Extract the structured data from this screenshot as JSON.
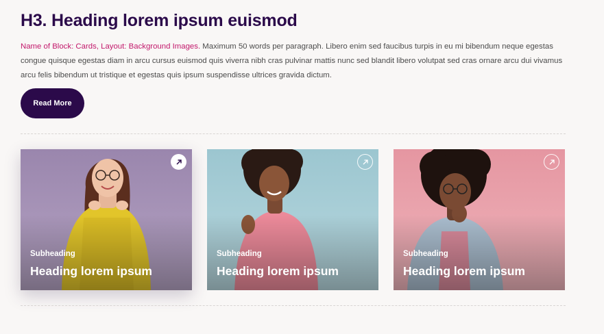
{
  "section": {
    "heading": "H3. Heading lorem ipsum euismod",
    "paragraph_highlight": "Name of Block: Cards, Layout: Background Images.",
    "paragraph_text": " Maximum 50 words per paragraph. Libero enim sed faucibus turpis in eu mi bibendum neque egestas congue quisque egestas diam in arcu cursus euismod quis viverra nibh cras pulvinar mattis nunc sed blandit libero volutpat sed cras ornare arcu dui vivamus arcu felis bibendum ut tristique et egestas quis ipsum suspendisse ultrices gravida dictum.",
    "button_label": "Read More"
  },
  "cards": [
    {
      "subheading": "Subheading",
      "heading": "Heading lorem ipsum",
      "icon": "arrow-up-right-icon",
      "background": "#a995b8",
      "sweater": "#e2c52a"
    },
    {
      "subheading": "Subheading",
      "heading": "Heading lorem ipsum",
      "icon": "arrow-up-right-icon",
      "background": "#a7cdd6",
      "sweater": "#ec8a9a"
    },
    {
      "subheading": "Subheading",
      "heading": "Heading lorem ipsum",
      "icon": "arrow-up-right-icon",
      "background": "#e8a3ac",
      "sweater": "#a9bccd"
    }
  ],
  "colors": {
    "accent": "#2b0a4a",
    "highlight": "#c2186b",
    "page_background": "#f9f7f6"
  }
}
